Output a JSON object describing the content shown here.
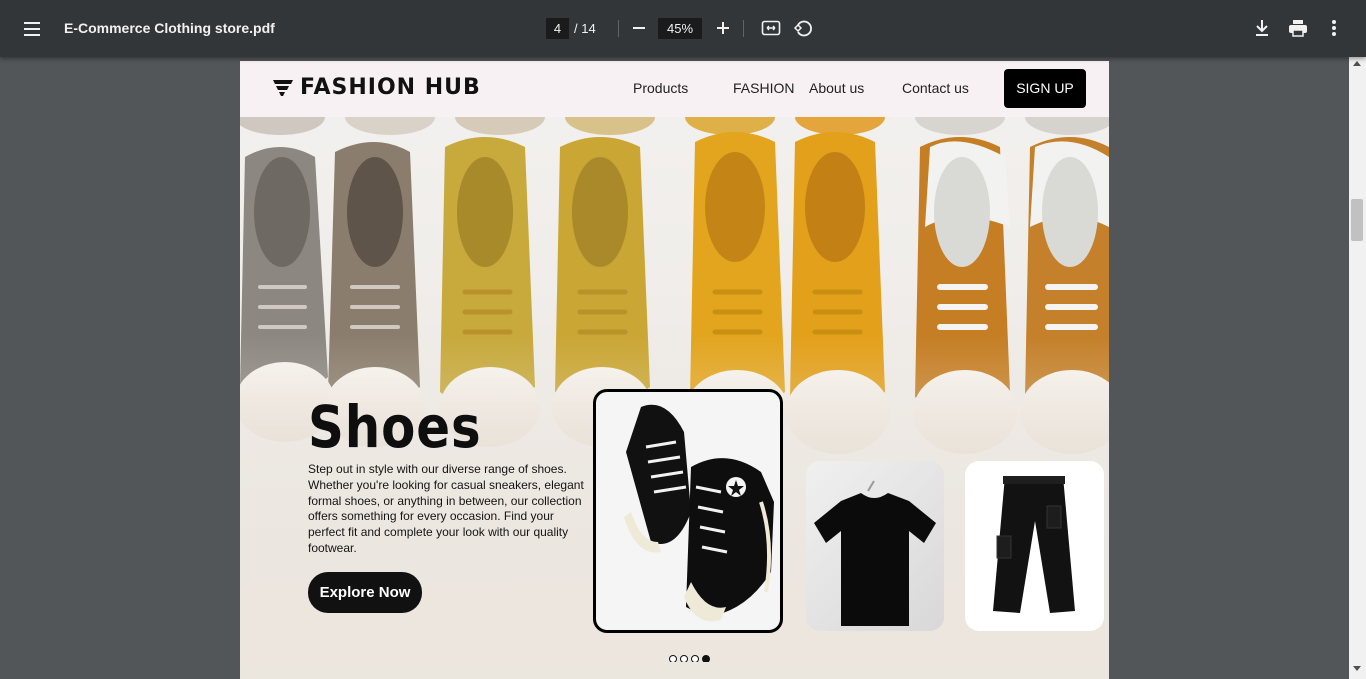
{
  "toolbar": {
    "title": "E-Commerce Clothing store.pdf",
    "page_current": "4",
    "page_total": "/ 14",
    "zoom": "45%",
    "icons": [
      "menu-icon",
      "zoom-out-icon",
      "zoom-in-icon",
      "fit-page-icon",
      "rotate-icon",
      "download-icon",
      "print-icon",
      "more-icon"
    ]
  },
  "site": {
    "logo_text": "FASHION HUB",
    "nav": {
      "products": "Products",
      "fashion": "FASHION",
      "about": "About us",
      "contact": "Contact us",
      "signup": "SIGN UP"
    },
    "hero": {
      "title": "Shoes",
      "description": "Step out in style with our diverse range of shoes. Whether you're looking for casual sneakers, elegant formal shoes, or anything in between, our collection offers something for every occasion. Find your perfect fit and complete your look with our quality footwear.",
      "cta": "Explore Now",
      "slides_total": 4,
      "slide_active": 4
    }
  },
  "colors": {
    "toolbar_bg": "#323639",
    "viewer_bg": "#525659",
    "nav_bg": "#f8f1f3",
    "accent": "#000000"
  }
}
